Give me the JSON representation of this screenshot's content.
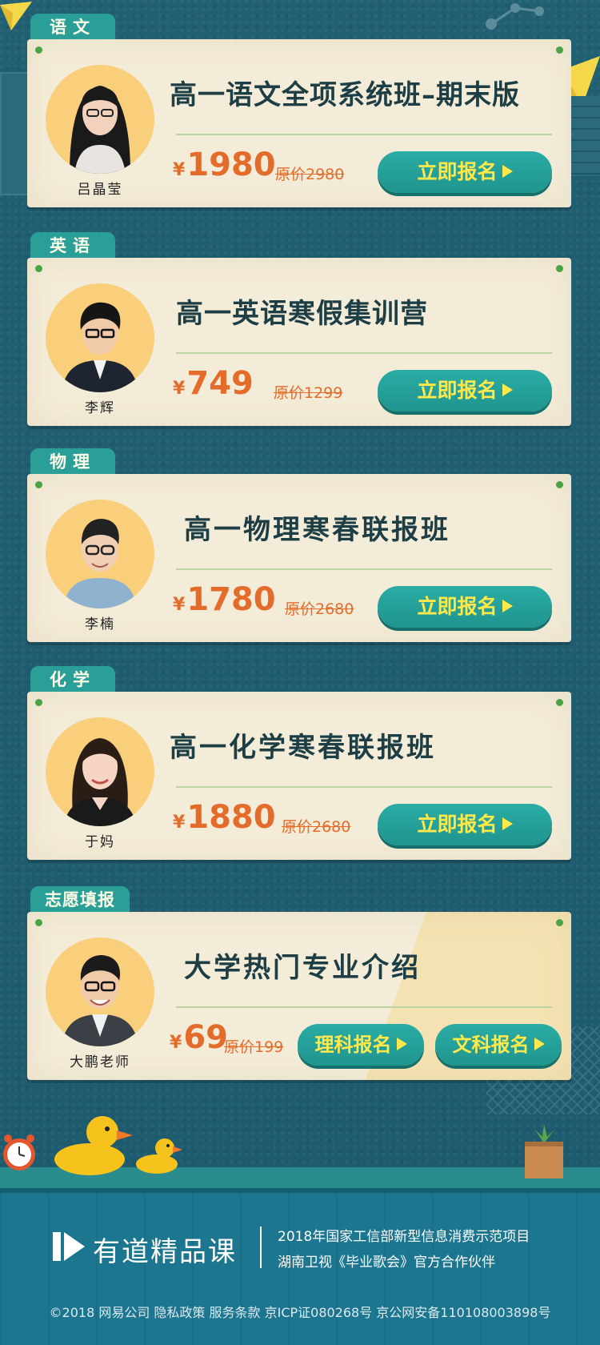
{
  "courses": [
    {
      "subject": "语文",
      "title": "高一语文全项系统班–期末版",
      "teacher": "吕晶莹",
      "price": "1980",
      "currency": "¥",
      "original_price": "原价2980",
      "button": "立即报名",
      "hair": "#1a1a1a",
      "shirt": "#e8e4df"
    },
    {
      "subject": "英语",
      "title": "高一英语寒假集训营",
      "teacher": "李辉",
      "price": "749",
      "currency": "¥",
      "original_price": "原价1299",
      "button": "立即报名",
      "hair": "#151515",
      "shirt": "#1e2430"
    },
    {
      "subject": "物理",
      "title": "高一物理寒春联报班",
      "teacher": "李楠",
      "price": "1780",
      "currency": "¥",
      "original_price": "原价2680",
      "button": "立即报名",
      "hair": "#222",
      "shirt": "#8fb2cf"
    },
    {
      "subject": "化学",
      "title": "高一化学寒春联报班",
      "teacher": "于妈",
      "price": "1880",
      "currency": "¥",
      "original_price": "原价2680",
      "button": "立即报名",
      "hair": "#2a1d16",
      "shirt": "#1a1a1a"
    },
    {
      "subject": "志愿填报",
      "title": "大学热门专业介绍",
      "teacher": "大鹏老师",
      "price": "69",
      "currency": "¥",
      "original_price": "原价199",
      "buttons": [
        "理科报名",
        "文科报名"
      ],
      "hair": "#1b1b1b",
      "shirt": "#3b3f46"
    }
  ],
  "footer": {
    "brand": "有道精品课",
    "line1": "2018年国家工信部新型信息消费示范项目",
    "line2": "湖南卫视《毕业歌会》官方合作伙伴",
    "copyright": "©2018 网易公司 隐私政策 服务条款 京ICP证080268号 京公网安备11010800389​8号"
  },
  "colors": {
    "accent": "#2aa59d",
    "price": "#e46c2b",
    "button_text": "#ffe84a",
    "card": "#f3ecd8",
    "background": "#1f5f73"
  },
  "icons": [
    "paper-plane-icon",
    "alarm-clock-icon",
    "rubber-duck-icon",
    "plant-icon",
    "play-logo-icon"
  ]
}
